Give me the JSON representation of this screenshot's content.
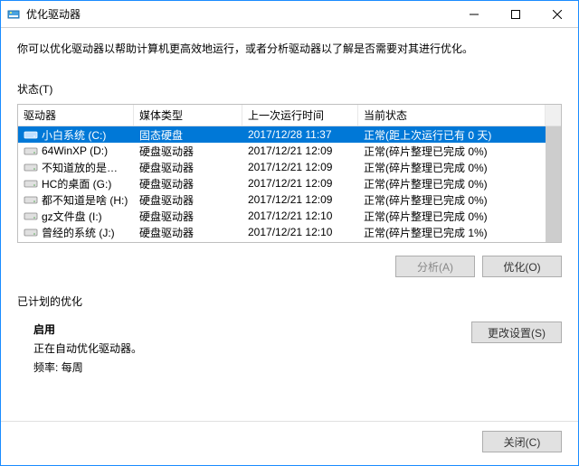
{
  "window": {
    "title": "优化驱动器"
  },
  "description": "你可以优化驱动器以帮助计算机更高效地运行，或者分析驱动器以了解是否需要对其进行优化。",
  "status_label": "状态(T)",
  "columns": {
    "drive": "驱动器",
    "media": "媒体类型",
    "last_run": "上一次运行时间",
    "current": "当前状态"
  },
  "drives": [
    {
      "name": "小白系统 (C:)",
      "media": "固态硬盘",
      "last_run": "2017/12/28 11:37",
      "status": "正常(距上次运行已有 0 天)",
      "selected": true
    },
    {
      "name": "64WinXP  (D:)",
      "media": "硬盘驱动器",
      "last_run": "2017/12/21 12:09",
      "status": "正常(碎片整理已完成 0%)",
      "selected": false
    },
    {
      "name": "不知道放的是什么 ...",
      "media": "硬盘驱动器",
      "last_run": "2017/12/21 12:09",
      "status": "正常(碎片整理已完成 0%)",
      "selected": false
    },
    {
      "name": "HC的桌面 (G:)",
      "media": "硬盘驱动器",
      "last_run": "2017/12/21 12:09",
      "status": "正常(碎片整理已完成 0%)",
      "selected": false
    },
    {
      "name": "都不知道是啥 (H:)",
      "media": "硬盘驱动器",
      "last_run": "2017/12/21 12:09",
      "status": "正常(碎片整理已完成 0%)",
      "selected": false
    },
    {
      "name": "gz文件盘 (I:)",
      "media": "硬盘驱动器",
      "last_run": "2017/12/21 12:10",
      "status": "正常(碎片整理已完成 0%)",
      "selected": false
    },
    {
      "name": "曾经的系统 (J:)",
      "media": "硬盘驱动器",
      "last_run": "2017/12/21 12:10",
      "status": "正常(碎片整理已完成 1%)",
      "selected": false
    }
  ],
  "buttons": {
    "analyze": "分析(A)",
    "optimize": "优化(O)",
    "change_settings": "更改设置(S)",
    "close": "关闭(C)"
  },
  "schedule": {
    "section_label": "已计划的优化",
    "enabled_label": "启用",
    "auto_text": "正在自动优化驱动器。",
    "freq_label": "频率:",
    "freq_value": "每周"
  }
}
